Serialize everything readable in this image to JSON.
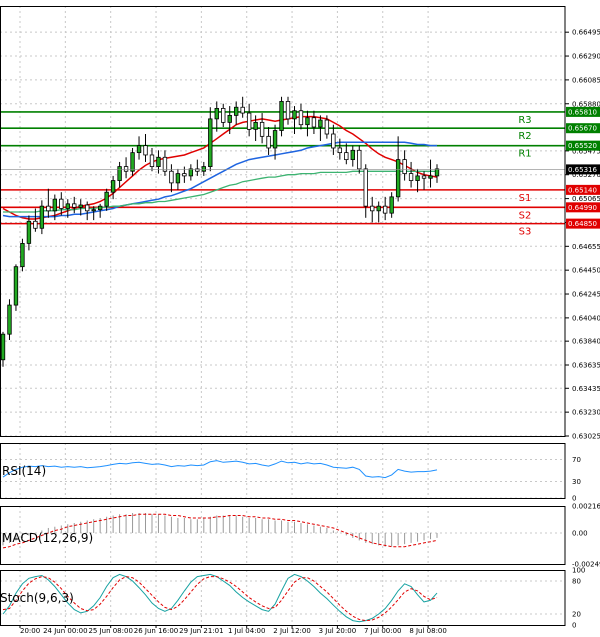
{
  "chart_data": [
    {
      "type": "candlestick",
      "ylim": [
        0.63025,
        0.6672
      ],
      "y_ticks": [
        "0.66495",
        "0.66290",
        "0.66085",
        "0.65880",
        "0.65475",
        "0.65270",
        "0.65065",
        "0.64860",
        "0.64655",
        "0.64450",
        "0.64245",
        "0.64040",
        "0.63840",
        "0.63635",
        "0.63435",
        "0.63230",
        "0.63025"
      ],
      "x_ticks": [
        "20:00",
        "24 Jun 00:00",
        "25 Jun 08:00",
        "26 Jun 16:00",
        "29 Jun 21:01",
        "1 Jul 04:00",
        "2 Jul 12:00",
        "3 Jul 20:00",
        "7 Jul 00:00",
        "8 Jul 08:00"
      ],
      "current_price": "0.65316",
      "levels": [
        {
          "name": "R3",
          "value": 0.6581,
          "label": "0.65810",
          "color": "#008000"
        },
        {
          "name": "R2",
          "value": 0.6567,
          "label": "0.65670",
          "color": "#008000"
        },
        {
          "name": "R1",
          "value": 0.6552,
          "label": "0.65520",
          "color": "#008000"
        },
        {
          "name": "S1",
          "value": 0.6514,
          "label": "0.65140",
          "color": "#e00000"
        },
        {
          "name": "S2",
          "value": 0.6499,
          "label": "0.64990",
          "color": "#e00000"
        },
        {
          "name": "S3",
          "value": 0.6485,
          "label": "0.64850",
          "color": "#e00000"
        }
      ],
      "candles": [
        [
          0.6368,
          0.6392,
          0.6362,
          0.639
        ],
        [
          0.639,
          0.642,
          0.6385,
          0.6415
        ],
        [
          0.6415,
          0.645,
          0.641,
          0.6448
        ],
        [
          0.6448,
          0.6472,
          0.6444,
          0.6468
        ],
        [
          0.6468,
          0.6492,
          0.6462,
          0.6487
        ],
        [
          0.6487,
          0.6498,
          0.6478,
          0.6481
        ],
        [
          0.6481,
          0.6505,
          0.6476,
          0.65
        ],
        [
          0.65,
          0.6515,
          0.649,
          0.6496
        ],
        [
          0.6496,
          0.651,
          0.6488,
          0.6506
        ],
        [
          0.6506,
          0.6512,
          0.6492,
          0.6498
        ],
        [
          0.6498,
          0.6506,
          0.649,
          0.6502
        ],
        [
          0.6502,
          0.6508,
          0.6494,
          0.6499
        ],
        [
          0.6499,
          0.6506,
          0.6492,
          0.6501
        ],
        [
          0.6501,
          0.6504,
          0.6488,
          0.6496
        ],
        [
          0.6496,
          0.65,
          0.6488,
          0.6497
        ],
        [
          0.6497,
          0.6502,
          0.649,
          0.65
        ],
        [
          0.65,
          0.6515,
          0.6496,
          0.6512
        ],
        [
          0.6512,
          0.6526,
          0.6506,
          0.6522
        ],
        [
          0.6522,
          0.6538,
          0.6516,
          0.6534
        ],
        [
          0.6534,
          0.6542,
          0.6524,
          0.653
        ],
        [
          0.653,
          0.655,
          0.6526,
          0.6546
        ],
        [
          0.6546,
          0.656,
          0.654,
          0.6552
        ],
        [
          0.6552,
          0.6562,
          0.6538,
          0.6544
        ],
        [
          0.6544,
          0.655,
          0.653,
          0.6534
        ],
        [
          0.6534,
          0.6548,
          0.6528,
          0.6542
        ],
        [
          0.6542,
          0.6548,
          0.6526,
          0.653
        ],
        [
          0.653,
          0.6536,
          0.6512,
          0.652
        ],
        [
          0.652,
          0.6532,
          0.6514,
          0.6528
        ],
        [
          0.6528,
          0.6534,
          0.652,
          0.6526
        ],
        [
          0.6526,
          0.6536,
          0.6522,
          0.6532
        ],
        [
          0.6532,
          0.654,
          0.6526,
          0.653
        ],
        [
          0.653,
          0.6538,
          0.6526,
          0.6534
        ],
        [
          0.6534,
          0.6585,
          0.653,
          0.6575
        ],
        [
          0.6575,
          0.659,
          0.6564,
          0.6584
        ],
        [
          0.6584,
          0.6588,
          0.6568,
          0.6572
        ],
        [
          0.6572,
          0.6586,
          0.6562,
          0.6578
        ],
        [
          0.6578,
          0.659,
          0.657,
          0.6585
        ],
        [
          0.6585,
          0.6594,
          0.6576,
          0.658
        ],
        [
          0.658,
          0.6588,
          0.656,
          0.6566
        ],
        [
          0.6566,
          0.6578,
          0.6556,
          0.6572
        ],
        [
          0.6572,
          0.658,
          0.6554,
          0.656
        ],
        [
          0.656,
          0.6568,
          0.6544,
          0.655
        ],
        [
          0.655,
          0.657,
          0.654,
          0.6565
        ],
        [
          0.6565,
          0.6594,
          0.656,
          0.659
        ],
        [
          0.659,
          0.6594,
          0.657,
          0.6575
        ],
        [
          0.6575,
          0.6586,
          0.6562,
          0.6582
        ],
        [
          0.6582,
          0.6588,
          0.6566,
          0.657
        ],
        [
          0.657,
          0.6582,
          0.656,
          0.6576
        ],
        [
          0.6576,
          0.6582,
          0.6562,
          0.6568
        ],
        [
          0.6568,
          0.6578,
          0.6556,
          0.6574
        ],
        [
          0.6574,
          0.6578,
          0.6558,
          0.6562
        ],
        [
          0.6562,
          0.657,
          0.6544,
          0.655
        ],
        [
          0.655,
          0.6558,
          0.654,
          0.6546
        ],
        [
          0.6546,
          0.6554,
          0.6536,
          0.654
        ],
        [
          0.654,
          0.6552,
          0.6534,
          0.6548
        ],
        [
          0.6548,
          0.6552,
          0.6528,
          0.6532
        ],
        [
          0.6532,
          0.6536,
          0.649,
          0.65
        ],
        [
          0.65,
          0.6508,
          0.6486,
          0.6496
        ],
        [
          0.6496,
          0.6504,
          0.6486,
          0.65
        ],
        [
          0.65,
          0.6508,
          0.6488,
          0.6494
        ],
        [
          0.6494,
          0.6512,
          0.649,
          0.6508
        ],
        [
          0.6508,
          0.656,
          0.6504,
          0.654
        ],
        [
          0.654,
          0.6548,
          0.6522,
          0.6528
        ],
        [
          0.6528,
          0.6538,
          0.6516,
          0.6522
        ],
        [
          0.6522,
          0.6532,
          0.6512,
          0.6526
        ],
        [
          0.6526,
          0.653,
          0.6514,
          0.6524
        ],
        [
          0.6524,
          0.654,
          0.6516,
          0.6526
        ],
        [
          0.6526,
          0.6536,
          0.652,
          0.6532
        ]
      ],
      "overlays": [
        {
          "name": "ma-red",
          "color": "#e00000",
          "values": [
            0.6498,
            0.6495,
            0.6492,
            0.649,
            0.6489,
            0.6489,
            0.649,
            0.6491,
            0.6492,
            0.6494,
            0.6496,
            0.6498,
            0.65,
            0.6501,
            0.6502,
            0.6504,
            0.6507,
            0.6511,
            0.6516,
            0.6521,
            0.6526,
            0.6531,
            0.6535,
            0.6538,
            0.654,
            0.6541,
            0.6542,
            0.6543,
            0.6544,
            0.6546,
            0.6548,
            0.655,
            0.6554,
            0.6558,
            0.6562,
            0.6566,
            0.657,
            0.6572,
            0.6573,
            0.6574,
            0.6575,
            0.6574,
            0.6573,
            0.6574,
            0.6575,
            0.6576,
            0.6577,
            0.6577,
            0.6577,
            0.6576,
            0.6575,
            0.6572,
            0.6569,
            0.6565,
            0.6562,
            0.6558,
            0.6554,
            0.6549,
            0.6545,
            0.6542,
            0.654,
            0.6538,
            0.6535,
            0.6532,
            0.6529,
            0.6527,
            0.6526,
            0.6525
          ]
        },
        {
          "name": "ma-blue",
          "color": "#1e64e0",
          "values": [
            0.6492,
            0.6491,
            0.6491,
            0.6491,
            0.6491,
            0.6491,
            0.6491,
            0.6491,
            0.6491,
            0.6492,
            0.6492,
            0.6493,
            0.6493,
            0.6494,
            0.6495,
            0.6496,
            0.6497,
            0.6498,
            0.65,
            0.6501,
            0.6502,
            0.6503,
            0.6504,
            0.6505,
            0.6506,
            0.6508,
            0.6509,
            0.6511,
            0.6513,
            0.6515,
            0.6518,
            0.6521,
            0.6524,
            0.6527,
            0.653,
            0.6533,
            0.6536,
            0.6538,
            0.654,
            0.6541,
            0.6542,
            0.6543,
            0.6544,
            0.6545,
            0.6546,
            0.6547,
            0.6548,
            0.655,
            0.6551,
            0.6552,
            0.6553,
            0.6554,
            0.6555,
            0.6555,
            0.6555,
            0.6555,
            0.6555,
            0.6555,
            0.6555,
            0.6555,
            0.6555,
            0.6555,
            0.6555,
            0.6554,
            0.6553,
            0.6553,
            0.6552,
            0.6552
          ]
        },
        {
          "name": "ma-green",
          "color": "#3cb371",
          "values": [
            0.6495,
            0.6495,
            0.6495,
            0.6495,
            0.6495,
            0.6495,
            0.6496,
            0.6496,
            0.6496,
            0.6497,
            0.6497,
            0.6497,
            0.6498,
            0.6498,
            0.6498,
            0.6499,
            0.6499,
            0.65,
            0.65,
            0.6501,
            0.6502,
            0.6502,
            0.6503,
            0.6503,
            0.6504,
            0.6504,
            0.6505,
            0.6506,
            0.6507,
            0.6508,
            0.6509,
            0.651,
            0.6512,
            0.6514,
            0.6516,
            0.6518,
            0.6519,
            0.6521,
            0.6522,
            0.6523,
            0.6524,
            0.6525,
            0.6525,
            0.6526,
            0.6527,
            0.6527,
            0.6528,
            0.6528,
            0.6528,
            0.6529,
            0.6529,
            0.6529,
            0.6529,
            0.6529,
            0.653,
            0.653,
            0.653,
            0.653,
            0.653,
            0.653,
            0.653,
            0.653,
            0.653,
            0.653,
            0.653,
            0.653,
            0.653,
            0.653
          ]
        }
      ]
    },
    {
      "type": "line",
      "name": "RSI(14)",
      "label": "RSI(14)",
      "ylim": [
        0,
        100
      ],
      "y_ticks": [
        "70",
        "30",
        "0"
      ],
      "values": [
        38,
        46,
        52,
        56,
        58,
        57,
        59,
        57,
        58,
        56,
        57,
        56,
        57,
        55,
        56,
        57,
        59,
        61,
        63,
        62,
        64,
        65,
        63,
        61,
        62,
        60,
        57,
        59,
        58,
        60,
        59,
        60,
        66,
        68,
        65,
        66,
        67,
        65,
        62,
        63,
        60,
        58,
        62,
        67,
        64,
        65,
        62,
        64,
        62,
        63,
        60,
        56,
        55,
        54,
        56,
        52,
        40,
        38,
        39,
        37,
        42,
        52,
        49,
        47,
        48,
        48,
        49,
        51
      ]
    },
    {
      "type": "bar",
      "name": "MACD(12,26,9)",
      "label": "MACD(12,26,9)",
      "ylim": [
        -0.002493,
        0.002164
      ],
      "y_ticks": [
        "0.002164",
        "0.00",
        "-0.002493"
      ],
      "histogram": [
        -0.001,
        -0.0008,
        -0.0006,
        -0.0004,
        -0.0002,
        0.0,
        0.0002,
        0.0004,
        0.0005,
        0.0006,
        0.0007,
        0.0008,
        0.0009,
        0.001,
        0.0011,
        0.0012,
        0.0013,
        0.0014,
        0.0015,
        0.0015,
        0.0016,
        0.0016,
        0.0016,
        0.0015,
        0.0015,
        0.0014,
        0.0013,
        0.0012,
        0.0012,
        0.0011,
        0.0011,
        0.0012,
        0.0013,
        0.0014,
        0.0014,
        0.0014,
        0.0014,
        0.0013,
        0.0012,
        0.0012,
        0.0011,
        0.0011,
        0.001,
        0.001,
        0.0009,
        0.0009,
        0.0008,
        0.0007,
        0.0006,
        0.0005,
        0.0004,
        0.0002,
        0.0,
        -0.0002,
        -0.0004,
        -0.0006,
        -0.0008,
        -0.0009,
        -0.001,
        -0.0011,
        -0.0011,
        -0.001,
        -0.0009,
        -0.0008,
        -0.0007,
        -0.0006,
        -0.0005,
        -0.0004
      ],
      "signal": [
        -0.0012,
        -0.0011,
        -0.0009,
        -0.0008,
        -0.0006,
        -0.0004,
        -0.0002,
        0.0,
        0.0002,
        0.0003,
        0.0005,
        0.0006,
        0.0007,
        0.0008,
        0.0009,
        0.001,
        0.0011,
        0.0012,
        0.0013,
        0.0014,
        0.0014,
        0.0015,
        0.0015,
        0.0015,
        0.0015,
        0.0015,
        0.0014,
        0.0014,
        0.0013,
        0.0012,
        0.0012,
        0.0012,
        0.0012,
        0.0013,
        0.0013,
        0.0014,
        0.0014,
        0.0014,
        0.0013,
        0.0013,
        0.0012,
        0.0012,
        0.0011,
        0.0011,
        0.001,
        0.001,
        0.0009,
        0.0008,
        0.0007,
        0.0006,
        0.0005,
        0.0004,
        0.0002,
        0.0,
        -0.0002,
        -0.0004,
        -0.0006,
        -0.0008,
        -0.0009,
        -0.001,
        -0.0011,
        -0.0011,
        -0.0011,
        -0.001,
        -0.0009,
        -0.0008,
        -0.0007,
        -0.0006
      ]
    },
    {
      "type": "line",
      "name": "Stoch(9,6,3)",
      "label": "Stoch(9,6,3)",
      "ylim": [
        0,
        100
      ],
      "y_ticks": [
        "100",
        "80",
        "20",
        "0"
      ],
      "series": [
        {
          "color": "#16a2a2",
          "values": [
            20,
            35,
            58,
            75,
            85,
            88,
            90,
            82,
            70,
            55,
            40,
            28,
            22,
            25,
            35,
            50,
            70,
            86,
            92,
            88,
            80,
            68,
            55,
            40,
            30,
            25,
            30,
            45,
            62,
            78,
            88,
            90,
            92,
            88,
            80,
            72,
            60,
            50,
            42,
            35,
            28,
            25,
            38,
            62,
            85,
            92,
            88,
            80,
            70,
            58,
            48,
            36,
            25,
            15,
            8,
            6,
            8,
            12,
            20,
            30,
            45,
            62,
            75,
            70,
            55,
            42,
            45,
            58
          ]
        },
        {
          "color": "#e00000",
          "values": [
            28,
            30,
            45,
            62,
            76,
            84,
            88,
            86,
            78,
            66,
            52,
            40,
            30,
            26,
            28,
            38,
            52,
            68,
            82,
            88,
            86,
            78,
            66,
            54,
            42,
            32,
            28,
            34,
            46,
            60,
            74,
            84,
            88,
            88,
            84,
            78,
            70,
            60,
            50,
            42,
            35,
            30,
            32,
            45,
            62,
            78,
            86,
            86,
            80,
            70,
            60,
            48,
            36,
            25,
            16,
            10,
            8,
            9,
            14,
            22,
            33,
            46,
            60,
            66,
            62,
            52,
            46,
            50
          ]
        }
      ]
    }
  ]
}
